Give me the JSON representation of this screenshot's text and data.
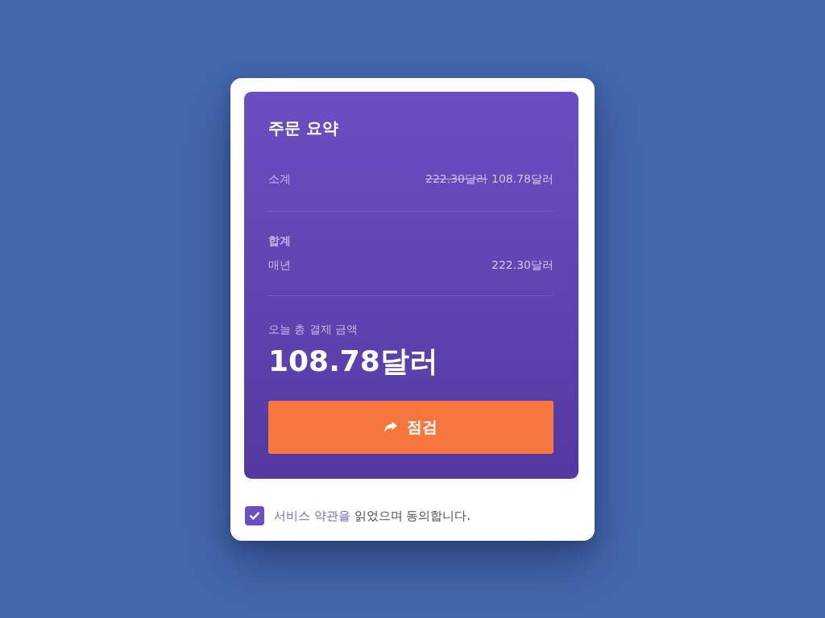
{
  "title": "주문 요약",
  "subtotal": {
    "label": "소계",
    "original_price": "222.30달러",
    "price": "108.78달러"
  },
  "total": {
    "label": "합계",
    "period": "매년",
    "amount": "222.30달러"
  },
  "due_today": {
    "label": "오늘 총 결제 금액",
    "amount": "108.78달러"
  },
  "checkout_button": {
    "label": "점검"
  },
  "terms": {
    "checked": true,
    "link": "서비스 약관을",
    "text": "읽었으며 동의합니다."
  }
}
